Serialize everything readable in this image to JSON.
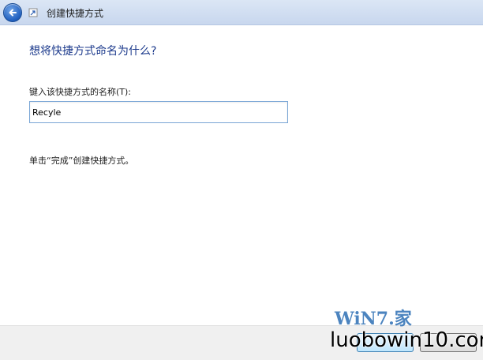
{
  "window": {
    "title": "创建快捷方式"
  },
  "main": {
    "heading": "想将快捷方式命名为什么?",
    "field_label": "键入该快捷方式的名称(T):",
    "name_value": "Recyle",
    "hint": "单击“完成”创建快捷方式。"
  },
  "icons": {
    "back": "back-arrow-icon",
    "shortcut": "shortcut-icon"
  },
  "watermark": {
    "logo_text": "WiN7.家",
    "site_text": "luobowin10.com"
  },
  "colors": {
    "heading": "#1c3a8c",
    "titlebar": "#c8d7ee",
    "input_border": "#7aa6d6"
  }
}
